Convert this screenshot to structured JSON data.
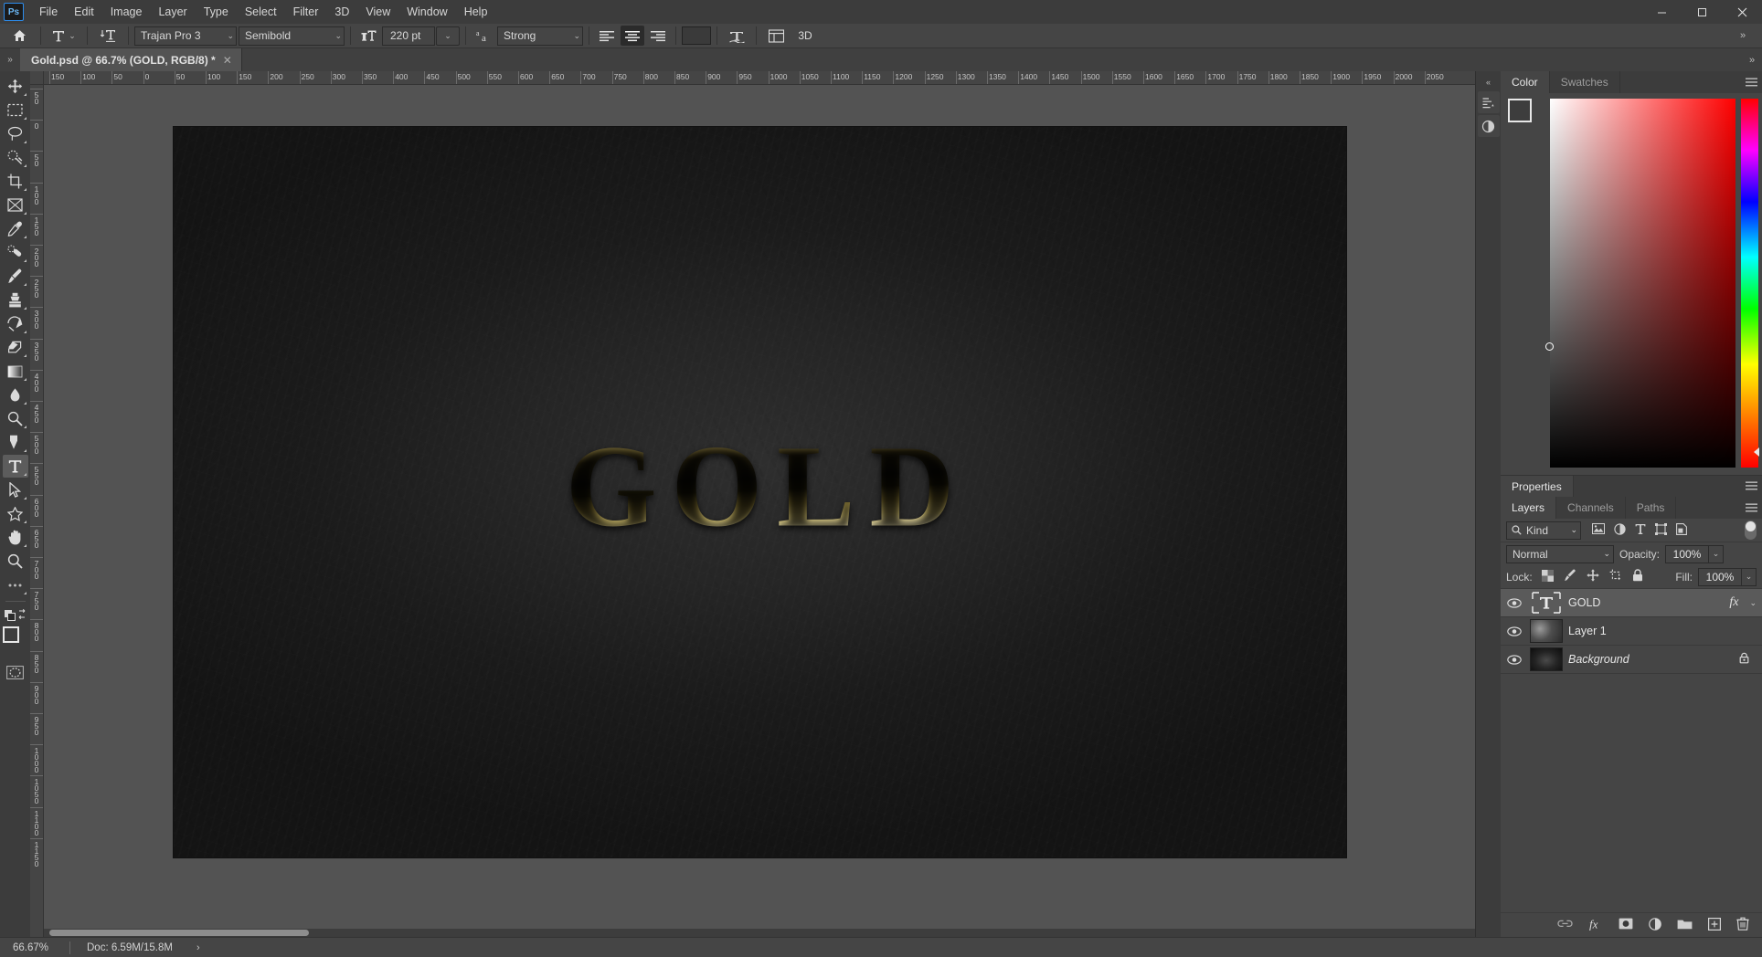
{
  "app": {
    "logo": "Ps",
    "menus": [
      "File",
      "Edit",
      "Image",
      "Layer",
      "Type",
      "Select",
      "Filter",
      "3D",
      "View",
      "Window",
      "Help"
    ],
    "window_controls": {
      "minimize": "─",
      "maximize": "☐",
      "close": "✕"
    }
  },
  "options_bar": {
    "home_icon": "home-icon",
    "tool_icon": "type-tool-icon",
    "orientation_icon": "text-orientation-icon",
    "font_family": "Trajan Pro 3",
    "font_style": "Semibold",
    "size_icon": "font-size-icon",
    "font_size": "220 pt",
    "antialias_icon": "anti-alias-icon",
    "antialias": "Strong",
    "align_left": "align-left-icon",
    "align_center": "align-center-icon",
    "align_right": "align-right-icon",
    "color_swatch": "#3a3a3a",
    "warp_icon": "warp-text-icon",
    "panels_icon": "toggle-panels-icon",
    "threed_label": "3D",
    "overflow": "»"
  },
  "tab_bar": {
    "collapse": "»",
    "document_title": "Gold.psd @ 66.7% (GOLD, RGB/8) *",
    "close": "✕"
  },
  "toolbar": {
    "tools": [
      {
        "name": "move-tool",
        "label": "Move Tool"
      },
      {
        "name": "rectangular-marquee-tool",
        "label": "Rectangular Marquee Tool"
      },
      {
        "name": "lasso-tool",
        "label": "Lasso Tool"
      },
      {
        "name": "quick-selection-tool",
        "label": "Quick Selection Tool"
      },
      {
        "name": "crop-tool",
        "label": "Crop Tool"
      },
      {
        "name": "frame-tool",
        "label": "Frame Tool"
      },
      {
        "name": "eyedropper-tool",
        "label": "Eyedropper Tool"
      },
      {
        "name": "healing-brush-tool",
        "label": "Spot Healing Brush Tool"
      },
      {
        "name": "brush-tool",
        "label": "Brush Tool"
      },
      {
        "name": "clone-stamp-tool",
        "label": "Clone Stamp Tool"
      },
      {
        "name": "history-brush-tool",
        "label": "History Brush Tool"
      },
      {
        "name": "eraser-tool",
        "label": "Eraser Tool"
      },
      {
        "name": "gradient-tool",
        "label": "Gradient Tool"
      },
      {
        "name": "blur-tool",
        "label": "Blur Tool"
      },
      {
        "name": "dodge-tool",
        "label": "Dodge Tool"
      },
      {
        "name": "pen-tool",
        "label": "Pen Tool"
      },
      {
        "name": "type-tool",
        "label": "Horizontal Type Tool"
      },
      {
        "name": "path-selection-tool",
        "label": "Path Selection Tool"
      },
      {
        "name": "custom-shape-tool",
        "label": "Custom Shape Tool"
      },
      {
        "name": "hand-tool",
        "label": "Hand Tool"
      },
      {
        "name": "zoom-tool",
        "label": "Zoom Tool"
      },
      {
        "name": "edit-toolbar",
        "label": "Edit Toolbar"
      }
    ],
    "active_tool": "type-tool",
    "swap_colors_icon": "swap-colors-icon",
    "default_colors_icon": "default-colors-icon",
    "foreground_color": "#3d3d3d",
    "background_color": "#161616",
    "quick_mask_icon": "quick-mask-icon"
  },
  "rulers": {
    "unit": "px",
    "h_labels": [
      "150",
      "100",
      "50",
      "0",
      "50",
      "100",
      "150",
      "200",
      "250",
      "300",
      "350",
      "400",
      "450",
      "500",
      "550",
      "600",
      "650",
      "700",
      "750",
      "800",
      "850",
      "900",
      "950",
      "1000",
      "1050",
      "1100",
      "1150",
      "1200",
      "1250",
      "1300",
      "1350",
      "1400",
      "1450",
      "1500",
      "1550",
      "1600",
      "1650",
      "1700",
      "1750",
      "1800",
      "1850",
      "1900",
      "1950",
      "2000",
      "2050"
    ],
    "v_labels": [
      "50",
      "0",
      "50",
      "100",
      "150",
      "200",
      "250",
      "300",
      "350",
      "400",
      "450",
      "500",
      "550",
      "600",
      "650",
      "700",
      "750",
      "800",
      "850",
      "900",
      "950",
      "1000",
      "1050",
      "1100",
      "1150"
    ]
  },
  "canvas": {
    "artwork_text": "GOLD",
    "background_color": "#1c1c1c"
  },
  "rail": {
    "collapse_icon": "«",
    "buttons": [
      {
        "name": "history-rail-icon"
      },
      {
        "name": "adjustments-rail-icon"
      }
    ]
  },
  "color_panel": {
    "tabs": [
      {
        "label": "Color",
        "active": true
      },
      {
        "label": "Swatches",
        "active": false
      }
    ],
    "menu_icon": "panel-menu-icon",
    "foreground_color": "#3d3d3d",
    "background_color": "#151515"
  },
  "properties_panel": {
    "tabs": [
      {
        "label": "Properties",
        "active": true
      }
    ],
    "menu_icon": "panel-menu-icon"
  },
  "layers_panel": {
    "tabs": [
      {
        "label": "Layers",
        "active": true
      },
      {
        "label": "Channels",
        "active": false
      },
      {
        "label": "Paths",
        "active": false
      }
    ],
    "menu_icon": "panel-menu-icon",
    "filter": {
      "search_icon": "search-icon",
      "kind_label": "Kind",
      "caret": "⌄",
      "icons": [
        "pixel-filter-icon",
        "adjustment-filter-icon",
        "type-filter-icon",
        "shape-filter-icon",
        "smart-object-filter-icon"
      ],
      "toggle": "filter-toggle"
    },
    "blend_mode": "Normal",
    "opacity_label": "Opacity:",
    "opacity_value": "100%",
    "lock_label": "Lock:",
    "lock_icons": [
      "lock-transparent-pixels-icon",
      "lock-image-pixels-icon",
      "lock-position-icon",
      "lock-artboard-icon",
      "lock-all-icon"
    ],
    "fill_label": "Fill:",
    "fill_value": "100%",
    "layers": [
      {
        "name": "GOLD",
        "kind": "text",
        "selected": true,
        "visible": true,
        "has_fx": true,
        "locked": false,
        "italic": false,
        "fx_label": "fx",
        "fx_caret": "⌄"
      },
      {
        "name": "Layer 1",
        "kind": "pixel",
        "selected": false,
        "visible": true,
        "has_fx": false,
        "locked": false,
        "italic": false
      },
      {
        "name": "Background",
        "kind": "pixel",
        "selected": false,
        "visible": true,
        "has_fx": false,
        "locked": true,
        "italic": true
      }
    ],
    "footer_icons": [
      "link-layers-icon",
      "add-layer-style-icon",
      "add-layer-mask-icon",
      "new-adjustment-layer-icon",
      "new-group-icon",
      "new-layer-icon",
      "delete-layer-icon"
    ]
  },
  "status_bar": {
    "zoom": "66.67%",
    "doc_info": "Doc: 6.59M/15.8M",
    "arrow": "›"
  }
}
